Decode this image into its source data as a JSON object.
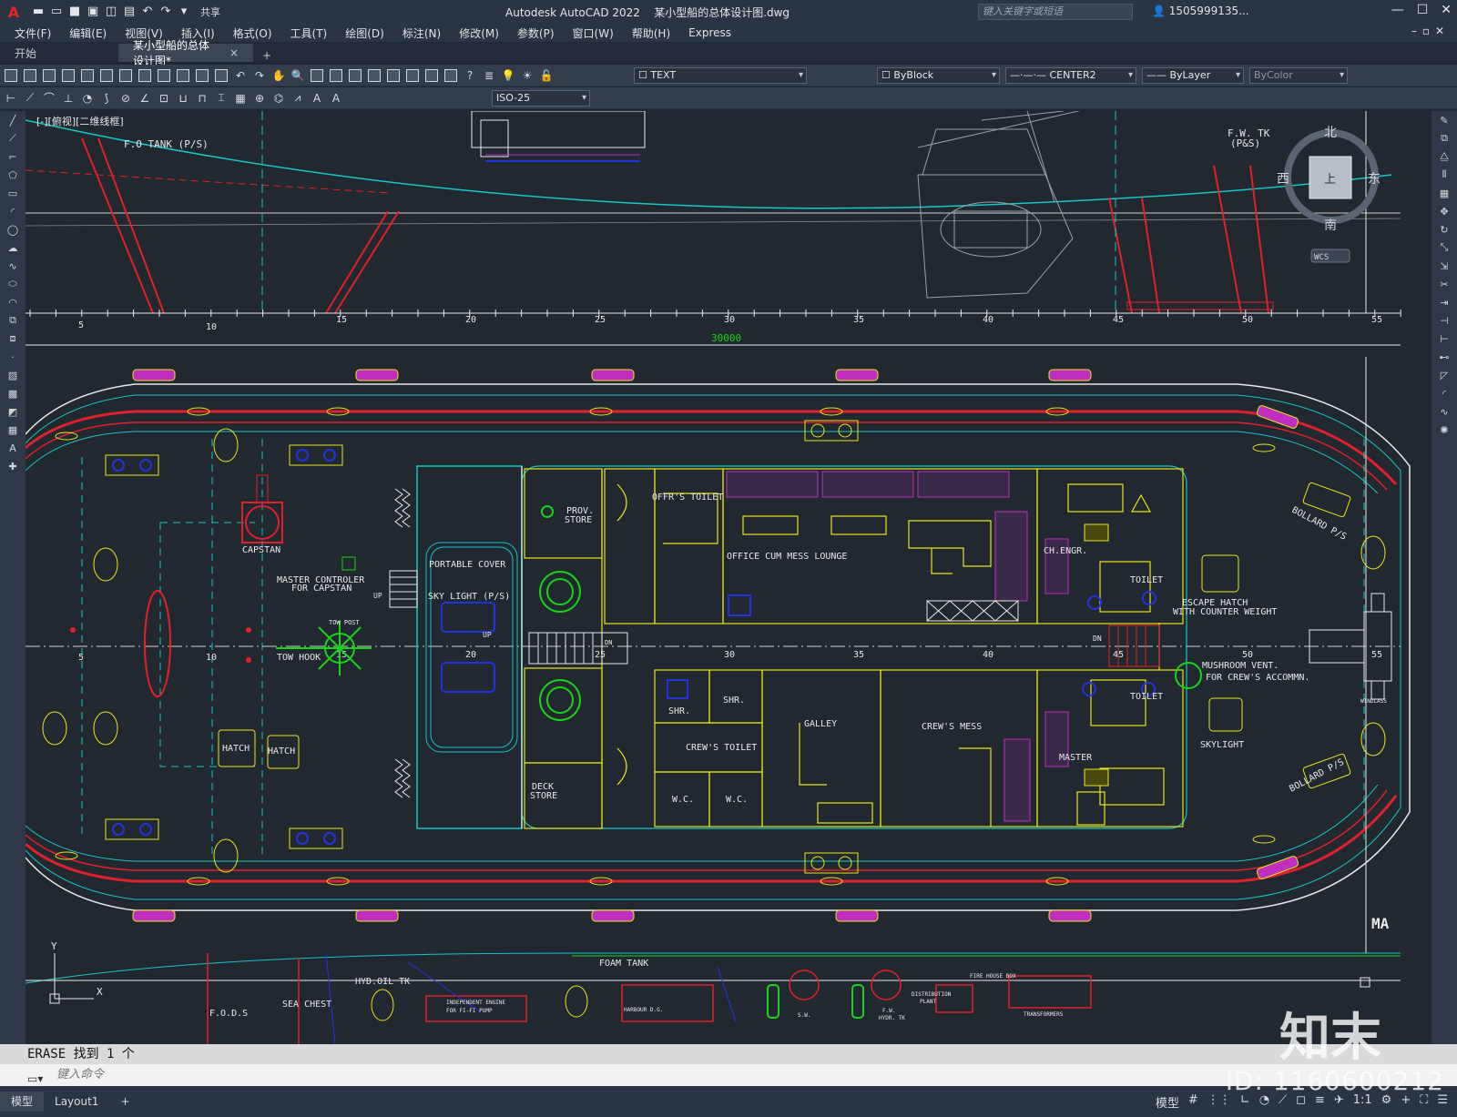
{
  "app": {
    "title": "Autodesk AutoCAD 2022",
    "document": "某小型船的总体设计图.dwg",
    "search_placeholder": "键入关键字或短语",
    "user": "1505999135...",
    "share_label": "共享"
  },
  "menu": [
    "文件(F)",
    "编辑(E)",
    "视图(V)",
    "插入(I)",
    "格式(O)",
    "工具(T)",
    "绘图(D)",
    "标注(N)",
    "修改(M)",
    "参数(P)",
    "窗口(W)",
    "帮助(H)",
    "Express"
  ],
  "tabs": {
    "start": "开始",
    "active": "某小型船的总体设计图*",
    "close": "×",
    "add": "+"
  },
  "toolbar": {
    "layer_value": "TEXT",
    "color_value": "ByBlock",
    "linetype_value": "CENTER2",
    "lineweight_value": "ByLayer",
    "plotstyle_value": "ByColor",
    "dimstyle_value": "ISO-25"
  },
  "viewport": {
    "label": "[-][俯视][二维线框]",
    "compass": {
      "north": "北",
      "south": "南",
      "east": "东",
      "west": "西",
      "top": "上"
    },
    "wcs": "WCS",
    "dim_total": "30000"
  },
  "drawing": {
    "top_labels": [
      "F.O TANK (P/S)",
      "F.W. TK",
      "(P&S)"
    ],
    "frame_numbers": [
      "5",
      "10",
      "15",
      "20",
      "25",
      "30",
      "35",
      "40",
      "45",
      "50",
      "55"
    ],
    "deck_labels": {
      "capstan": "CAPSTAN",
      "master_controller": "MASTER CONTROLER",
      "for_capstan": "FOR CAPSTAN",
      "tow_hook": "TOW HOOK",
      "tow_post": "TOW POST",
      "hatch1": "HATCH",
      "hatch2": "HATCH",
      "portable_cover": "PORTABLE COVER",
      "sky_light": "SKY LIGHT (P/S)",
      "prov_store": "PROV.",
      "store": "STORE",
      "deck_store": "DECK",
      "deck_store2": "STORE",
      "offrs_toilet": "OFFR'S TOILET",
      "office": "OFFICE CUM MESS LOUNGE",
      "ch_engr": "CH.ENGR.",
      "toilet1": "TOILET",
      "toilet2": "TOILET",
      "escape_hatch": "ESCAPE HATCH",
      "counter_weight": "WITH COUNTER WEIGHT",
      "mushroom": "MUSHROOM VENT.",
      "for_crew": "FOR CREW'S ACCOMMN.",
      "skylight": "SKYLIGHT",
      "bollard1": "BOLLARD P/S",
      "bollard2": "BOLLARD P/S",
      "shr1": "SHR.",
      "shr2": "SHR.",
      "crews_toilet": "CREW'S TOILET",
      "galley": "GALLEY",
      "crews_mess": "CREW'S MESS",
      "master": "MASTER",
      "wc1": "W.C.",
      "wc2": "W.C.",
      "up1": "UP",
      "up2": "UP",
      "dn1": "DN",
      "dn2": "DN",
      "windlass": "WINDLASS",
      "ma": "MA"
    },
    "bottom_labels": {
      "foam_tank": "FOAM TANK",
      "hyd_oil": "HYD.OIL TK",
      "sea_chest": "SEA CHEST",
      "fods": "F.O.D.S",
      "indep_engine": "INDEPENDENT ENGINE",
      "for_pump": "FOR FI-FI PUMP",
      "harbour": "HARBOUR D.G.",
      "sw": "S.W.",
      "fw": "F.W.",
      "hydr_tk": "HYDR. TK",
      "distribution": "DISTRIBUTION",
      "plant": "PLANT",
      "fire_house": "FIRE HOUSE BOX",
      "transformers": "TRANSFORMERS"
    }
  },
  "command": {
    "history": "ERASE 找到 1 个",
    "placeholder": "键入命令"
  },
  "status": {
    "tabs": [
      "模型",
      "Layout1",
      "+"
    ],
    "model_label": "模型",
    "scale": "1:1"
  },
  "watermark": {
    "logo": "知末",
    "id": "ID: 1160600212"
  },
  "colors": {
    "canvas": "#212830",
    "red": "#e0202a",
    "yellow": "#e6e61a",
    "cyan": "#17c6c6",
    "magenta": "#c02ec0",
    "blue": "#2233dd",
    "green": "#19d219",
    "white": "#e8e8e8"
  }
}
